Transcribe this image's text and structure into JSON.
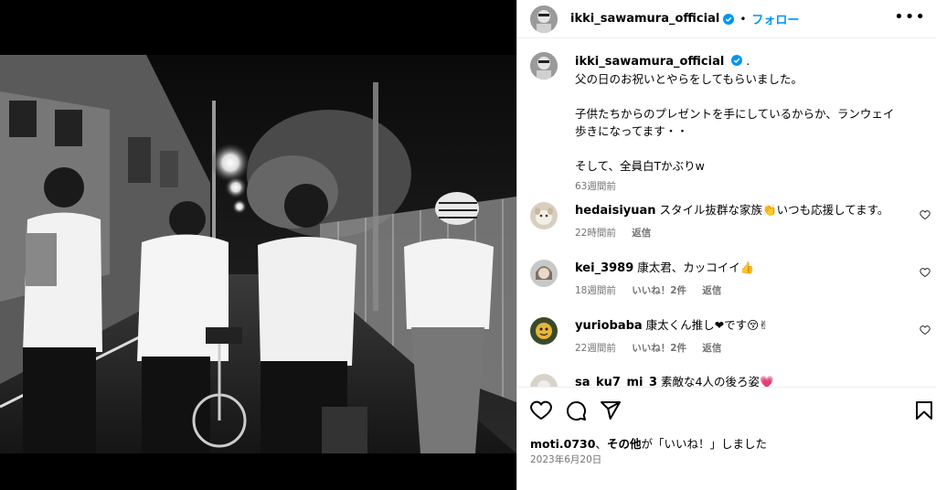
{
  "post": {
    "username": "ikki_sawamura_official",
    "follow_label": "フォロー",
    "separator": "•",
    "more_label": "•••",
    "caption_suffix": ".",
    "caption_lines": [
      "父の日のお祝いとやらをしてもらいました。",
      "",
      "子供たちからのプレゼントを手にしているからか、ランウェイ",
      "歩きになってます・・",
      "",
      "そして、全員白Tかぶりw"
    ],
    "caption_time": "63週間前"
  },
  "comments": [
    {
      "username": "hedaisiyuan",
      "text": "スタイル抜群な家族👏いつも応援してます。",
      "time": "22時間前",
      "likes": "",
      "reply": "返信"
    },
    {
      "username": "kei_3989",
      "text": "康太君、カッコイイ👍",
      "time": "18週間前",
      "likes": "いいね！2件",
      "reply": "返信"
    },
    {
      "username": "yuriobaba",
      "text": "康太くん推し❤です😚✌",
      "time": "22週間前",
      "likes": "いいね！2件",
      "reply": "返信"
    },
    {
      "username": "sa_ku7_mi_3",
      "text": "素敵な4人の後ろ姿💗",
      "time": "",
      "likes": "",
      "reply": ""
    }
  ],
  "footer": {
    "liked_by_user": "moti.0730",
    "liked_by_mid": "、",
    "liked_by_others": "その他",
    "liked_by_tail": "が「いいね！」しました",
    "date": "2023年6月20日"
  },
  "colors": {
    "accent": "#0095f6",
    "verified": "#0095f6",
    "muted": "#737373"
  },
  "icons": [
    "heart-icon",
    "comment-icon",
    "share-icon",
    "bookmark-icon",
    "verified-badge-icon",
    "more-icon"
  ]
}
